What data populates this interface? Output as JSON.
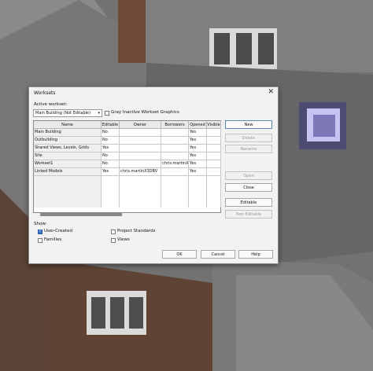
{
  "dialog": {
    "title": "Worksets",
    "close": "✕",
    "active_workset_label": "Active workset:",
    "active_workset_value": "Main Building (Not Editable)",
    "gray_inactive_label": "Gray Inactive Workset Graphics",
    "columns": [
      "Name",
      "Editable",
      "Owner",
      "Borrowers",
      "Opened",
      "Visible"
    ],
    "rows": [
      {
        "name": "Main Building",
        "editable": "No",
        "owner": "",
        "borrowers": "",
        "opened": "Yes",
        "visible": ""
      },
      {
        "name": "Outbuilding",
        "editable": "No",
        "owner": "",
        "borrowers": "",
        "opened": "Yes",
        "visible": ""
      },
      {
        "name": "Shared Views, Levels, Grids",
        "editable": "Yes",
        "owner": "",
        "borrowers": "",
        "opened": "Yes",
        "visible": ""
      },
      {
        "name": "Site",
        "editable": "No",
        "owner": "",
        "borrowers": "",
        "opened": "Yes",
        "visible": ""
      },
      {
        "name": "Workset1",
        "editable": "No",
        "owner": "",
        "borrowers": "chris.martinX",
        "opened": "Yes",
        "visible": ""
      },
      {
        "name": "Linked Models",
        "editable": "Yes",
        "owner": "chris.martinX3DBV",
        "borrowers": "",
        "opened": "Yes",
        "visible": ""
      }
    ],
    "show_label": "Show:",
    "show_user_created": "User-Created",
    "show_project_standards": "Project Standards",
    "show_families": "Families",
    "show_views": "Views",
    "buttons": {
      "new": "New",
      "delete": "Delete",
      "rename": "Rename",
      "open": "Open",
      "close": "Close",
      "editable": "Editable",
      "non_editable": "Non Editable",
      "ok": "OK",
      "cancel": "Cancel",
      "help": "Help"
    }
  }
}
